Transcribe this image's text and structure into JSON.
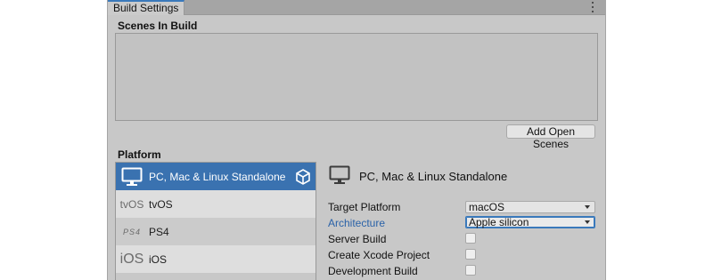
{
  "window": {
    "tab_title": "Build Settings"
  },
  "scenes": {
    "title": "Scenes In Build",
    "add_button": "Add Open Scenes"
  },
  "platform": {
    "title": "Platform",
    "items": [
      {
        "label": "PC, Mac & Linux Standalone",
        "icon": "monitor-icon",
        "selected": true
      },
      {
        "label": "tvOS",
        "icon": "tvos-logo-icon",
        "logo_text": "tvOS"
      },
      {
        "label": "PS4",
        "icon": "ps4-logo-icon",
        "logo_text": "PS4"
      },
      {
        "label": "iOS",
        "icon": "ios-logo-icon",
        "logo_text": "iOS"
      }
    ]
  },
  "details": {
    "title": "PC, Mac & Linux Standalone",
    "rows": {
      "target_platform_label": "Target Platform",
      "target_platform_value": "macOS",
      "architecture_label": "Architecture",
      "architecture_value": "Apple silicon",
      "server_build_label": "Server Build",
      "create_xcode_label": "Create Xcode Project",
      "development_build_label": "Development Build"
    }
  },
  "colors": {
    "selection": "#3a72b0",
    "accent": "#3a79bb",
    "highlight_label": "#2a62a8"
  }
}
